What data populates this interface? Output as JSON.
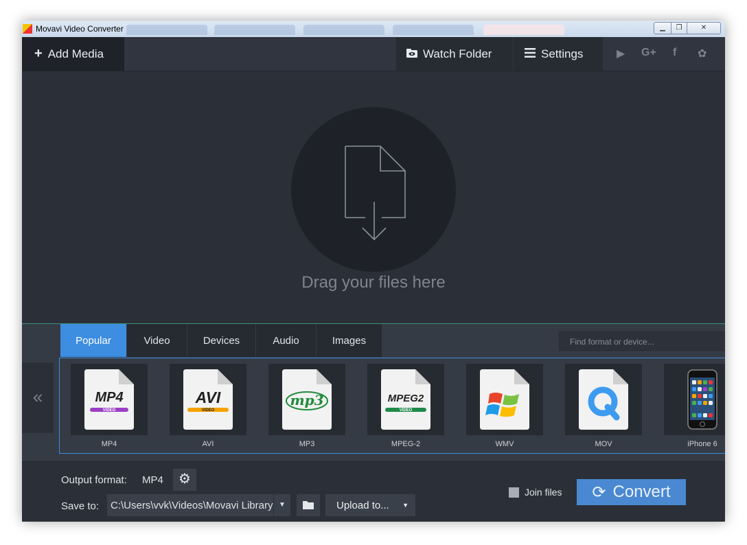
{
  "window": {
    "title": "Movavi Video Converter"
  },
  "toolbar": {
    "add_media": "Add Media",
    "watch_folder": "Watch Folder",
    "settings": "Settings",
    "socials": [
      "youtube-icon",
      "google-plus-icon",
      "facebook-icon",
      "movavi-icon"
    ],
    "social_glyphs": [
      "▶",
      "G+",
      "f",
      "✿"
    ]
  },
  "dropzone": {
    "text": "Drag your files here"
  },
  "formats": {
    "tabs": [
      "Popular",
      "Video",
      "Devices",
      "Audio",
      "Images"
    ],
    "active_tab": "Popular",
    "search_placeholder": "Find format or device...",
    "items": [
      {
        "label": "MP4",
        "badge": "MP4",
        "sub": "VIDEO",
        "color": "#9b3fc4"
      },
      {
        "label": "AVI",
        "badge": "AVI",
        "sub": "VIDEO",
        "color": "#f5a300"
      },
      {
        "label": "MP3",
        "badge": "mp3",
        "sub": "",
        "color": "#1f8a3a"
      },
      {
        "label": "MPEG-2",
        "badge": "MPEG2",
        "sub": "VIDEO",
        "color": "#1f8a4a"
      },
      {
        "label": "WMV",
        "badge": "",
        "sub": "",
        "color": "#e8442c"
      },
      {
        "label": "MOV",
        "badge": "",
        "sub": "",
        "color": "#3d9bf0"
      },
      {
        "label": "iPhone 6",
        "badge": "",
        "sub": "",
        "color": "#111111"
      }
    ]
  },
  "output": {
    "format_label": "Output format:",
    "format_value": "MP4",
    "save_label": "Save to:",
    "save_path": "C:\\Users\\vvk\\Videos\\Movavi Library",
    "upload": "Upload to...",
    "join_files": "Join files",
    "convert": "Convert"
  },
  "colors": {
    "accent": "#3d8de0",
    "convert": "#4a88d1",
    "teal_line": "#3c8f7e"
  }
}
